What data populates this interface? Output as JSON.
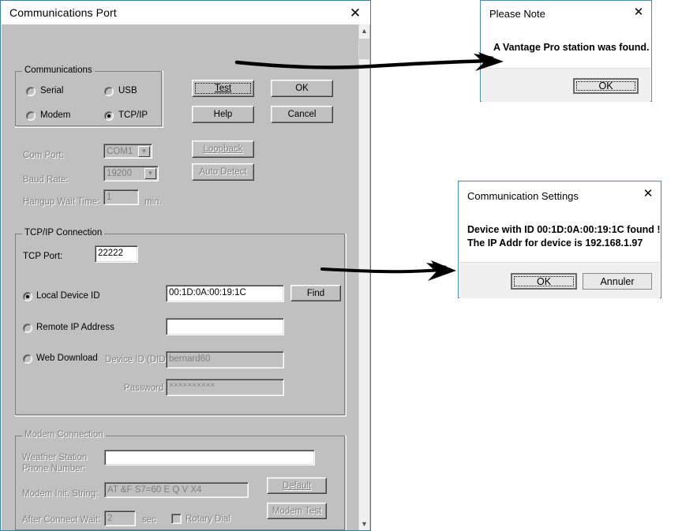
{
  "main_window": {
    "title": "Communications Port",
    "close_icon": "close-icon",
    "scrollbar": {
      "up_icon": "chevron-up-icon",
      "down_icon": "chevron-down-icon"
    },
    "communications_group": {
      "label": "Communications",
      "options": [
        {
          "label": "Serial",
          "selected": false
        },
        {
          "label": "USB",
          "selected": false
        },
        {
          "label": "Modem",
          "selected": false
        },
        {
          "label": "TCP/IP",
          "selected": true
        }
      ]
    },
    "buttons": [
      {
        "label": "Test",
        "accel": "T",
        "focused": true,
        "disabled": false
      },
      {
        "label": "OK",
        "accel": "O",
        "focused": false,
        "disabled": false
      },
      {
        "label": "Help",
        "accel": "",
        "focused": false,
        "disabled": false
      },
      {
        "label": "Cancel",
        "accel": "C",
        "focused": false,
        "disabled": false
      },
      {
        "label": "Loopback",
        "accel": "L",
        "focused": false,
        "disabled": true
      },
      {
        "label": "Auto Detect",
        "accel": "",
        "focused": false,
        "disabled": true
      }
    ],
    "serial_settings": {
      "com_port_label": "Com Port:",
      "com_port_value": "COM1",
      "baud_rate_label": "Baud Rate:",
      "baud_rate_value": "19200",
      "hangup_label": "Hangup Wait Time:",
      "hangup_value": "1",
      "hangup_units": "min."
    },
    "tcpip_group": {
      "label": "TCP/IP Connection",
      "tcp_port_label": "TCP Port:",
      "tcp_port_value": "22222",
      "local_device_id_label": "Local Device ID",
      "local_device_id_value": "00:1D:0A:00:19:1C",
      "local_device_id_selected": true,
      "find_button": "Find",
      "remote_ip_label": "Remote IP Address",
      "remote_ip_value": "",
      "remote_ip_selected": false,
      "web_download_label": "Web Download",
      "web_download_selected": false,
      "did_label": "Device ID (DID)",
      "did_value": "bernard60",
      "password_label": "Password",
      "password_value": "××××××××××"
    },
    "modem_group": {
      "label": "Modem Connection",
      "phone_label_line1": "Weather Station",
      "phone_label_line2": "Phone Number:",
      "phone_value": "",
      "init_string_label": "Modem Init. String:",
      "init_string_value": "AT &F S7=60 E Q V X4",
      "after_connect_label": "After Connect Wait:",
      "after_connect_value": "2",
      "after_connect_units": "sec",
      "rotary_dial_label": "Rotary Dial",
      "rotary_dial_checked": false,
      "default_button": "Default",
      "modem_test_button": "Modem Test"
    }
  },
  "please_note_dialog": {
    "title": "Please Note",
    "close_icon": "close-icon",
    "message": "A Vantage Pro station was found.",
    "ok_button": "OK"
  },
  "comm_settings_dialog": {
    "title": "Communication Settings",
    "close_icon": "close-icon",
    "message": "Device with ID  00:1D:0A:00:19:1C  found !\nThe IP Addr for device is 192.168.1.97",
    "ok_button": "OK",
    "cancel_button": "Annuler"
  },
  "annotations": {
    "arrow_1_name": "arrow-test-to-please-note",
    "arrow_2_name": "arrow-find-to-comm-settings"
  },
  "colors": {
    "dialog_border": "#4a8bb0",
    "classic_face": "#c0c0c0",
    "footer": "#f0f0f0"
  }
}
